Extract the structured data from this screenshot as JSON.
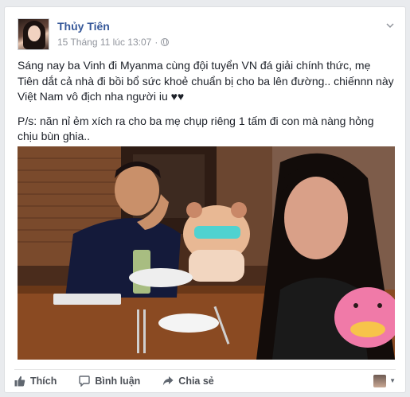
{
  "post": {
    "author": "Thủy Tiên",
    "timestamp": "15 Tháng 11 lúc 13:07",
    "separator": "·",
    "paragraph_1": "Sáng nay ba Vinh đi Myanma cùng đội tuyển VN đá giải chính thức, mẹ Tiên dắt cả nhà đi bồi bổ sức khoẻ chuẩn bị cho ba lên đường.. chiếnnn này Việt Nam vô địch nha người iu ♥♥",
    "paragraph_2": "P/s: năn nỉ ẻm xích ra cho ba mẹ chụp riêng 1 tấm đi con mà nàng hỏng chịu bùn ghia..",
    "privacy_icon": "globe-icon",
    "menu_icon": "chevron-down-icon"
  },
  "actions": {
    "like_label": "Thích",
    "comment_label": "Bình luận",
    "share_label": "Chia sẻ",
    "like_icon": "thumbs-up-icon",
    "comment_icon": "speech-bubble-icon",
    "share_icon": "share-arrow-icon"
  },
  "colors": {
    "author_link": "#365899",
    "meta_text": "#90949c",
    "action_text": "#4b4f56",
    "card_bg": "#ffffff",
    "page_bg": "#e9ebee"
  }
}
